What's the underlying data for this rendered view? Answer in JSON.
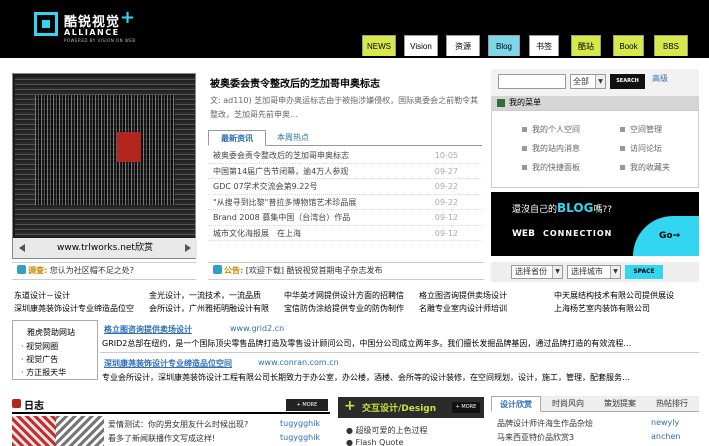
{
  "logo": {
    "name_cn": "酷锐视觉",
    "name_en": "ALLIANCE",
    "tagline": "POWERED BY VISION ON WEB",
    "plus": "+"
  },
  "nav": {
    "items": [
      {
        "label": "NEWS",
        "color": "#d7e84a"
      },
      {
        "label": "Vision",
        "color": "#ffffff"
      },
      {
        "label": "资源",
        "color": "#ffffff"
      },
      {
        "label": "Blog",
        "color": "#7fd6e9"
      },
      {
        "label": "书签",
        "color": "#ffffff"
      },
      {
        "label": "酷站",
        "color": "#d7e84a"
      },
      {
        "label": "Book",
        "color": "#d7e84a"
      },
      {
        "label": "BBS",
        "color": "#d7e84a"
      }
    ]
  },
  "feature": {
    "caption": "www.trlworks.net欣赏"
  },
  "headline": {
    "title": "被奥委会责令整改后的芝加哥申奥标志",
    "summary": "文: ad110) 芝加哥申办奥运标志由于被指涉嫌侵权，国际奥委会之前勒令其整改，芝加哥先前申奥…"
  },
  "news": {
    "tabs": [
      "最新资讯",
      "本周热点"
    ],
    "items": [
      {
        "title": "被奥委会责令整改后的芝加哥申奥标志",
        "date": "10-05"
      },
      {
        "title": "中国第14届广告节闭幕，逾4万人参观",
        "date": "09-27"
      },
      {
        "title": "GDC 07学术交流会第9.22号",
        "date": "09-22"
      },
      {
        "title": "\"从搜寻到比黎\"普拉多博物馆艺术珍品展",
        "date": "09-22"
      },
      {
        "title": "Brand 2008 募集中国（台湾台）作品",
        "date": "09-12"
      },
      {
        "title": "城市文化海报展　在上海",
        "date": "09-12"
      }
    ]
  },
  "search": {
    "select": "全部",
    "button": "SEARCH",
    "advanced": "高级"
  },
  "menu": {
    "title": "我的菜单",
    "items": [
      "我的个人空间",
      "空间管理",
      "我的站内消息",
      "访问论坛",
      "我的快捷面板",
      "我的收藏夹"
    ]
  },
  "blog_ad": {
    "line1_prefix": "還沒自己的",
    "line1_blog": "BLOG",
    "line1_suffix": "嗎??",
    "web": "WEB",
    "connection": "CONNECTION",
    "go": "Go→"
  },
  "strip": {
    "survey_label": "调查:",
    "survey_text": "您认为社区帽不足之处?",
    "notice_label": "公告:",
    "notice_text": "[欢迎下载] 酷锐视觉首期电子杂志发布"
  },
  "city": {
    "province": "选择省份",
    "city": "选择城市",
    "button": "SPACE"
  },
  "links": [
    "东道设计－设计",
    "金光设计，一流技术，一流品质",
    "中华英才网提供设计方面的招聘信",
    "格立图咨询提供卖场设计",
    "中天展结构技术有限公司提供展设",
    "深圳康荛装饰设计专业缔造品位空",
    "会所设计，广州雅拓明融设计有限",
    "宝信防伪涂给提供专业的防伪制作",
    "名雕专业室内设计师培训",
    "上海杨艺室内装饰有限公司"
  ],
  "sponsors": {
    "title": "雅虎赞助网站",
    "items": [
      "视觉网圈",
      "视觉广告",
      "方正报天华"
    ]
  },
  "ads": [
    {
      "title": "格立图咨询提供卖场设计",
      "url": "www.grid2.cn",
      "desc": "GRID2总部在纽约，是一个国际顶尖零售品牌打造及零售设计顾问公司，中国分公司成立两年多。我们擅长发掘品牌基因，通过品牌打造的有效流程…"
    },
    {
      "title": "深圳康荛装饰设计专业缔造品位空间",
      "url": "www.conran.com.cn",
      "desc": "专业会所设计，深圳康荛装饰设计工程有限公司长期致力于办公室，办公楼，酒楼、会所等的设计装修，在空间规划，设计，施工，管理，配套服务…"
    }
  ],
  "diary": {
    "title": "日志",
    "more": "+ MORE",
    "items": [
      {
        "text": "爱情测试：你的男女朋友什么时候出现?",
        "user": "tugygghik"
      },
      {
        "text": "看多了新闻联播作文写成这样!",
        "user": "tugygghik"
      }
    ]
  },
  "interact": {
    "plus": "+",
    "title": "交互设计/Design",
    "more": "+ MORE",
    "items": [
      "超级可爱的上色过程",
      "Flash Quote"
    ]
  },
  "rank": {
    "tabs": [
      "设计欣赏",
      "时尚风向",
      "策划提案",
      "热帖排行"
    ],
    "items": [
      {
        "title": "品牌设计师许海生作品杂烩",
        "user": "newyly"
      },
      {
        "title": "马来西亚特价品欣赏3",
        "user": "anchen"
      }
    ]
  }
}
